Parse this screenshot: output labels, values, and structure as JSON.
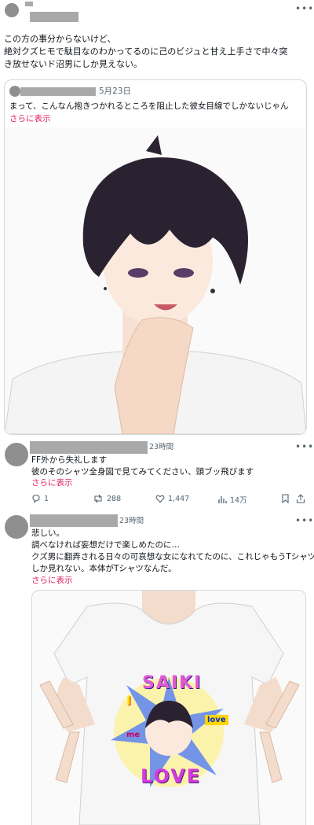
{
  "main_post": {
    "text_line1": "この方の事分からないけど、",
    "text_line2": "絶対クズヒモで駄目なのわかってるのに己のビジュと甘え上手さで中々突",
    "text_line3": "き放せないド沼男にしか見えない。"
  },
  "quoted_post": {
    "date": "5月23日",
    "text": "まって、こんなん抱きつかれるところを阻止した彼女目線でしかないじゃん",
    "show_more": "さらに表示"
  },
  "reply1": {
    "time": "23時間",
    "line1": "FF外から失礼します",
    "line2": "彼のそのシャツ全身図で見てみてください、頭ブッ飛びます",
    "show_more": "さらに表示",
    "actions": {
      "replies": "1",
      "reposts": "288",
      "likes": "1,447",
      "views": "14万"
    }
  },
  "reply2": {
    "time": "23時間",
    "line1": "悲しい。",
    "line2": "調べなければ妄想だけで楽しめたのに…",
    "line3": "クズ男に翻弄される日々の可哀想な女になれてたのに、これじゃもうTシャツ",
    "line4": "しか見れない。本体がTシャツなんだ。",
    "show_more": "さらに表示"
  },
  "shirt_print": {
    "top_text": "SAIKI",
    "bottom_text": "LOVE",
    "left_badge": "I",
    "left_small": "me",
    "right_badge": "love"
  },
  "icons": [
    "more-icon",
    "reply-icon",
    "repost-icon",
    "like-icon",
    "views-icon",
    "bookmark-icon",
    "share-icon"
  ],
  "colors": {
    "link": "#e0245e",
    "muted": "#536471",
    "border": "#cfd9de"
  }
}
